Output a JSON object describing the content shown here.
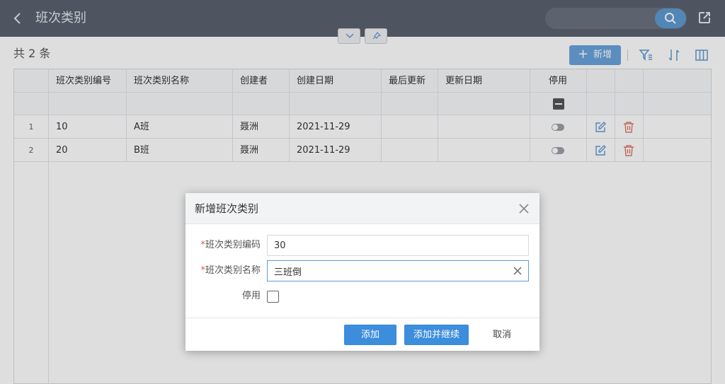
{
  "header": {
    "title": "班次类别"
  },
  "toolbar": {
    "count_text": "共 2 条",
    "add_label": "新增"
  },
  "table": {
    "columns": [
      "班次类别编号",
      "班次类别名称",
      "创建者",
      "创建日期",
      "最后更新",
      "更新日期",
      "停用"
    ],
    "rows": [
      {
        "index": "1",
        "code": "10",
        "name": "A班",
        "creator": "聂洲",
        "created": "2021-11-29",
        "last_update": "",
        "update_date": ""
      },
      {
        "index": "2",
        "code": "20",
        "name": "B班",
        "creator": "聂洲",
        "created": "2021-11-29",
        "last_update": "",
        "update_date": ""
      }
    ]
  },
  "dialog": {
    "title": "新增班次类别",
    "required_mark": "*",
    "code_label": "班次类别编码",
    "code_value": "30",
    "name_label": "班次类别名称",
    "name_value": "三班倒",
    "disable_label": "停用",
    "add_button": "添加",
    "add_continue_button": "添加并继续",
    "cancel_button": "取消"
  },
  "colors": {
    "header_bg": "#5a6270",
    "primary": "#3c8ddc",
    "danger_icon": "#e07a6a",
    "edit_icon": "#5f9ad3"
  }
}
